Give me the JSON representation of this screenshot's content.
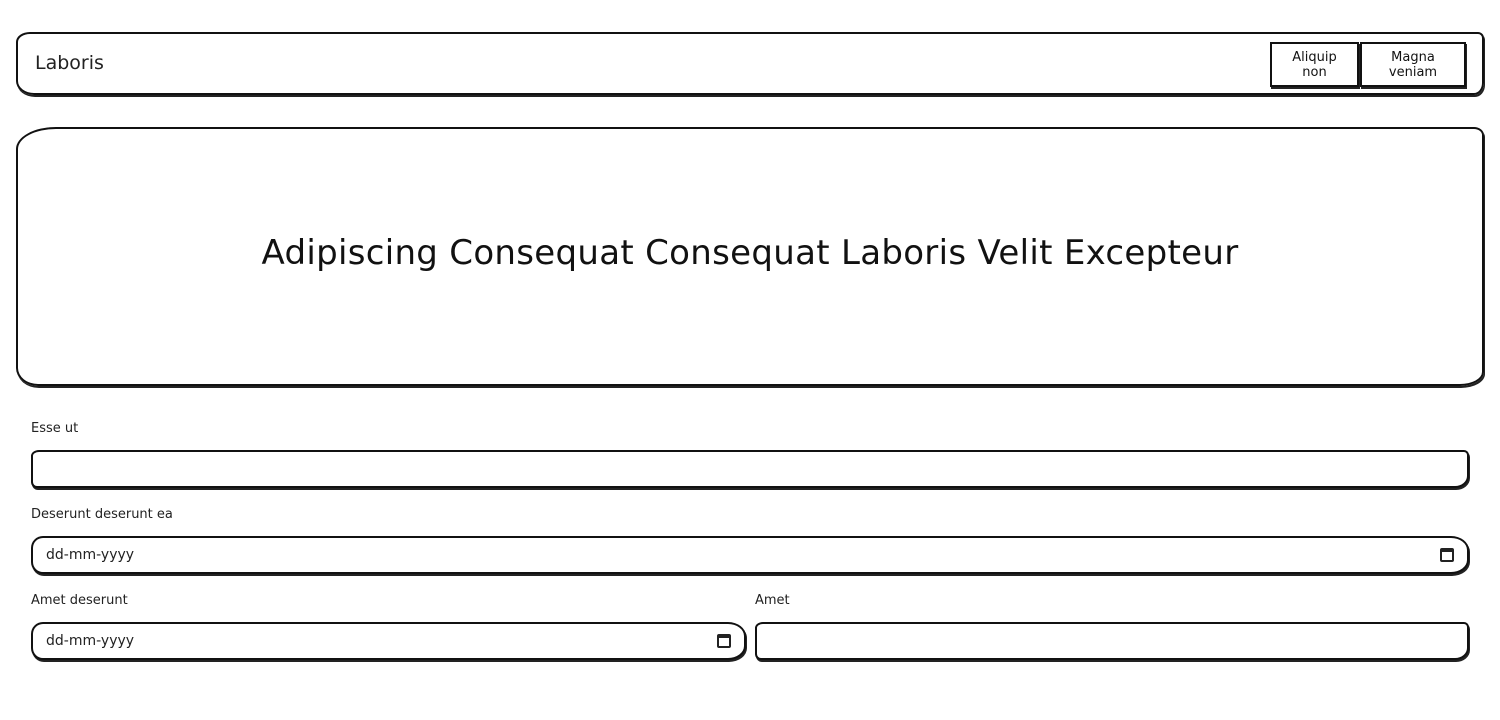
{
  "navbar": {
    "brand": "Laboris",
    "buttons": [
      {
        "label": "Aliquip non"
      },
      {
        "label": "Magna veniam"
      }
    ]
  },
  "hero": {
    "title": "Adipiscing Consequat Consequat Laboris Velit Excepteur"
  },
  "form": {
    "field1": {
      "label": "Esse ut",
      "value": ""
    },
    "field2": {
      "label": "Deserunt deserunt ea",
      "placeholder": "dd-mm-yyyy",
      "icon": "calendar-icon"
    },
    "field3": {
      "label": "Amet deserunt",
      "placeholder": "dd-mm-yyyy",
      "icon": "calendar-icon"
    },
    "field4": {
      "label": "Amet",
      "value": ""
    }
  }
}
